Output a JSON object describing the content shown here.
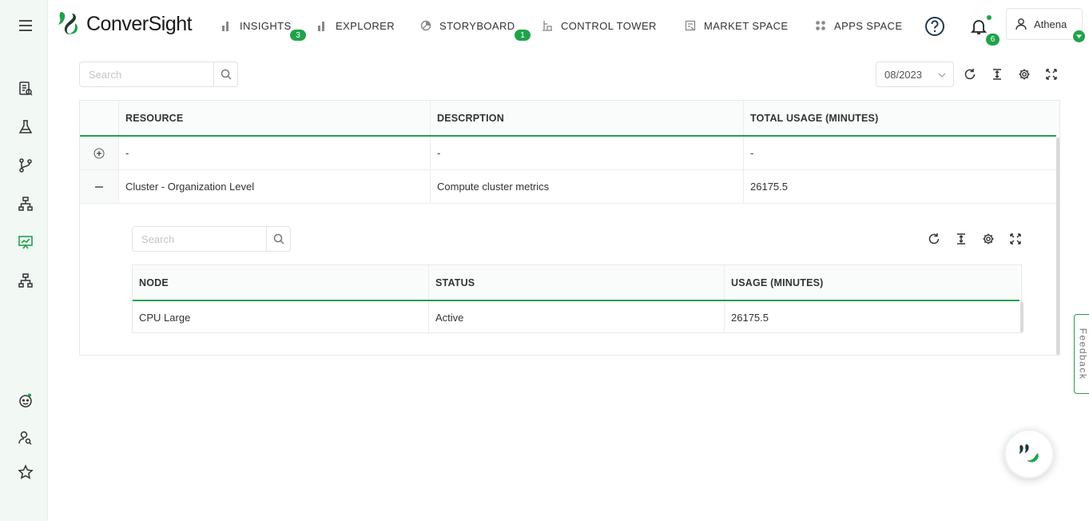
{
  "app": {
    "brand": "ConverSight"
  },
  "nav": {
    "items": [
      {
        "label": "INSIGHTS",
        "badge": "3",
        "icon": "bar-chart-icon"
      },
      {
        "label": "EXPLORER",
        "badge": "",
        "icon": "bar-chart-icon"
      },
      {
        "label": "STORYBOARD",
        "badge": "1",
        "icon": "pie-chart-icon"
      },
      {
        "label": "CONTROL TOWER",
        "badge": "",
        "icon": "tower-icon"
      },
      {
        "label": "MARKET SPACE",
        "badge": "",
        "icon": "market-icon"
      },
      {
        "label": "APPS SPACE",
        "badge": "",
        "icon": "apps-grid-icon"
      }
    ],
    "notifications_count": "6",
    "user_name": "Athena"
  },
  "sidebar": {
    "items": [
      "menu-icon",
      "report-search-icon",
      "flask-icon",
      "git-branch-icon",
      "hierarchy-icon",
      "presentation-chart-icon",
      "org-chart-icon",
      "bot-face-icon",
      "user-search-icon",
      "star-icon"
    ],
    "active": "presentation-chart-icon"
  },
  "toolbar": {
    "search_placeholder": "Search",
    "date_value": "08/2023"
  },
  "table": {
    "columns": [
      "RESOURCE",
      "DESCRPTION",
      "TOTAL USAGE (MINUTES)"
    ],
    "rows": [
      {
        "expanded": false,
        "cells": [
          "-",
          "-",
          "-"
        ]
      },
      {
        "expanded": true,
        "cells": [
          "Cluster - Organization Level",
          "Compute cluster metrics",
          "26175.5"
        ]
      }
    ]
  },
  "nested": {
    "search_placeholder": "Search",
    "columns": [
      "NODE",
      "STATUS",
      "USAGE (MINUTES)"
    ],
    "rows": [
      {
        "cells": [
          "CPU Large",
          "Active",
          "26175.5"
        ]
      }
    ]
  },
  "feedback_label": "Feedback",
  "colors": {
    "accent": "#1fa34a",
    "sidebar_bg": "#f2f8f4"
  }
}
